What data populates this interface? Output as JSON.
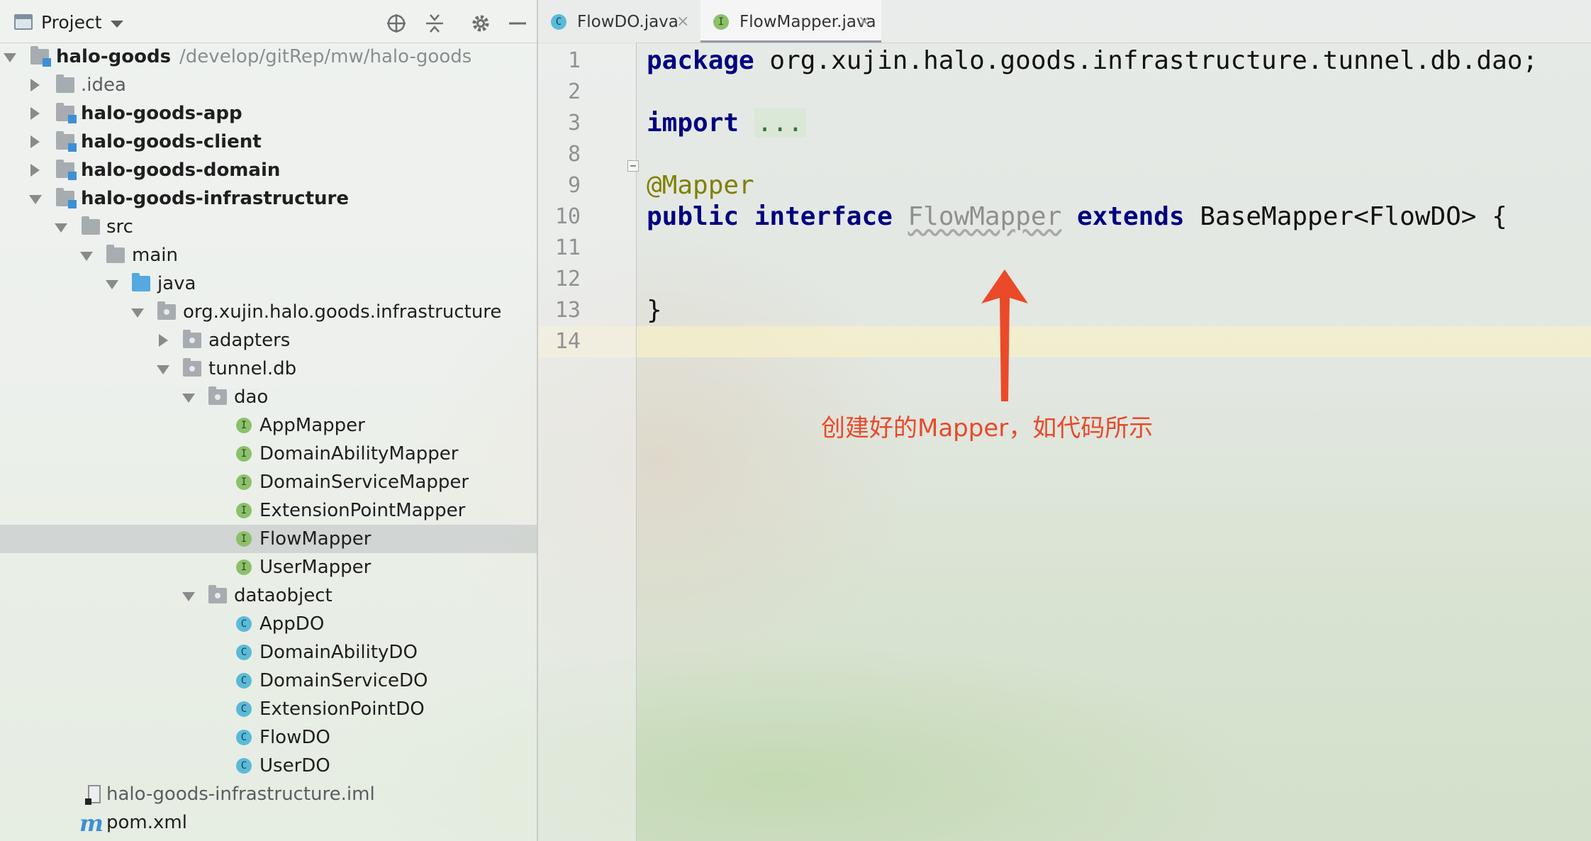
{
  "project_panel": {
    "title": "Project",
    "tree": [
      {
        "label": "halo-goods",
        "path": "/develop/gitRep/mw/halo-goods"
      },
      {
        "label": ".idea"
      },
      {
        "label": "halo-goods-app"
      },
      {
        "label": "halo-goods-client"
      },
      {
        "label": "halo-goods-domain"
      },
      {
        "label": "halo-goods-infrastructure"
      },
      {
        "label": "src"
      },
      {
        "label": "main"
      },
      {
        "label": "java"
      },
      {
        "label": "org.xujin.halo.goods.infrastructure"
      },
      {
        "label": "adapters"
      },
      {
        "label": "tunnel.db"
      },
      {
        "label": "dao"
      },
      {
        "label": "AppMapper",
        "badge": "I"
      },
      {
        "label": "DomainAbilityMapper",
        "badge": "I"
      },
      {
        "label": "DomainServiceMapper",
        "badge": "I"
      },
      {
        "label": "ExtensionPointMapper",
        "badge": "I"
      },
      {
        "label": "FlowMapper",
        "badge": "I"
      },
      {
        "label": "UserMapper",
        "badge": "I"
      },
      {
        "label": "dataobject"
      },
      {
        "label": "AppDO",
        "badge": "C"
      },
      {
        "label": "DomainAbilityDO",
        "badge": "C"
      },
      {
        "label": "DomainServiceDO",
        "badge": "C"
      },
      {
        "label": "ExtensionPointDO",
        "badge": "C"
      },
      {
        "label": "FlowDO",
        "badge": "C"
      },
      {
        "label": "UserDO",
        "badge": "C"
      },
      {
        "label": "halo-goods-infrastructure.iml"
      },
      {
        "label": "pom.xml",
        "icon_text": "m"
      }
    ]
  },
  "tabs": [
    {
      "label": "FlowDO.java",
      "badge": "C"
    },
    {
      "label": "FlowMapper.java",
      "badge": "I",
      "active": true
    }
  ],
  "close_glyph": "×",
  "line_numbers": [
    "1",
    "2",
    "3",
    "8",
    "9",
    "10",
    "11",
    "12",
    "13",
    "14"
  ],
  "code": {
    "l1_kw": "package",
    "l1_rest": " org.xujin.halo.goods.infrastructure.tunnel.db.dao;",
    "l3_kw": "import",
    "l3_fold": "...",
    "l9_annotation": "@Mapper",
    "l10_kw1": "public",
    "l10_kw2": "interface",
    "l10_name": "FlowMapper",
    "l10_kw3": "extends",
    "l10_rest": " BaseMapper<FlowDO> {",
    "l13": "}"
  },
  "annotation_note": "创建好的Mapper，如代码所示",
  "colors": {
    "keyword": "#000080",
    "annotation": "#808000",
    "note": "#e8492b",
    "interface_badge": "#8cc06a",
    "class_badge": "#5bbad8"
  },
  "icons": [
    "project-icon",
    "dropdown-icon",
    "locate-icon",
    "collapse-icon",
    "gear-icon",
    "minimize-icon",
    "folder-icon",
    "module-icon",
    "interface-icon",
    "class-icon",
    "iml-file-icon",
    "maven-icon",
    "close-icon",
    "fold-icon",
    "arrow-up-icon"
  ]
}
